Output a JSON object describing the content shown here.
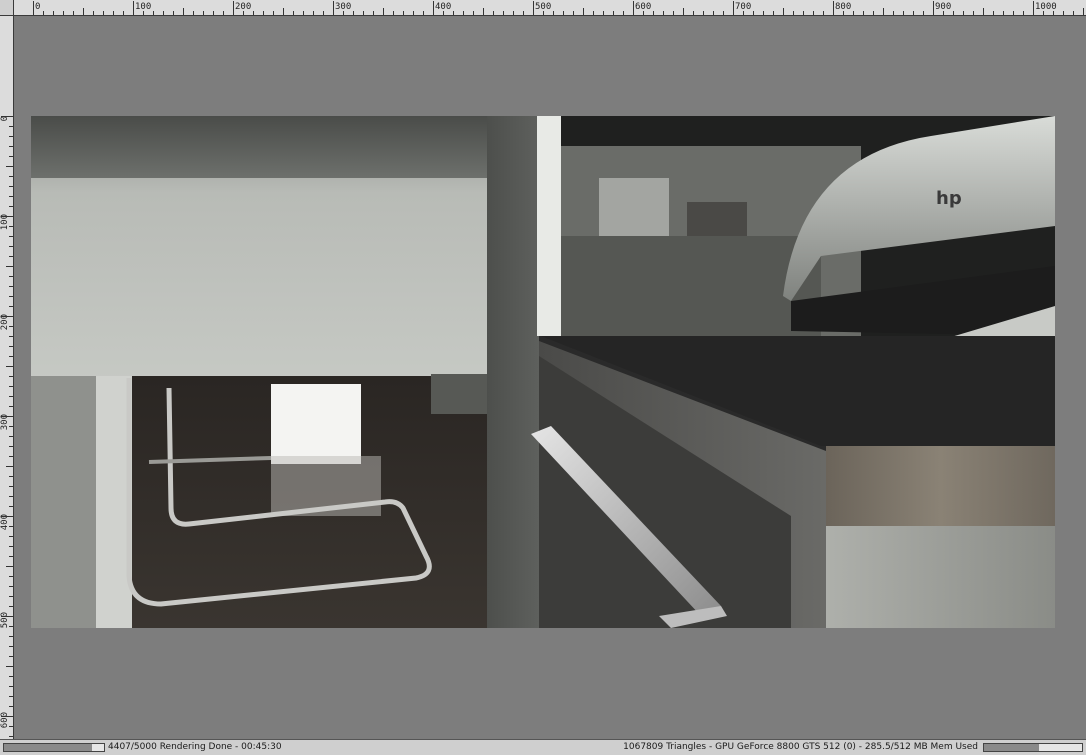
{
  "ruler": {
    "top_labels": [
      "0",
      "100",
      "200",
      "300",
      "400",
      "500",
      "600",
      "700",
      "800",
      "900",
      "1000"
    ],
    "left_labels": [
      "0",
      "100",
      "200",
      "300",
      "400",
      "500",
      "600"
    ]
  },
  "render": {
    "progress_fraction": 0.8814,
    "logo_text": "hp"
  },
  "status": {
    "left_text": "4407/5000 Rendering Done - 00:45:30",
    "right_text": "1067809 Triangles - GPU  GeForce 8800 GTS 512 (0) - 285.5/512 MB Mem Used",
    "mem_fraction": 0.557
  }
}
